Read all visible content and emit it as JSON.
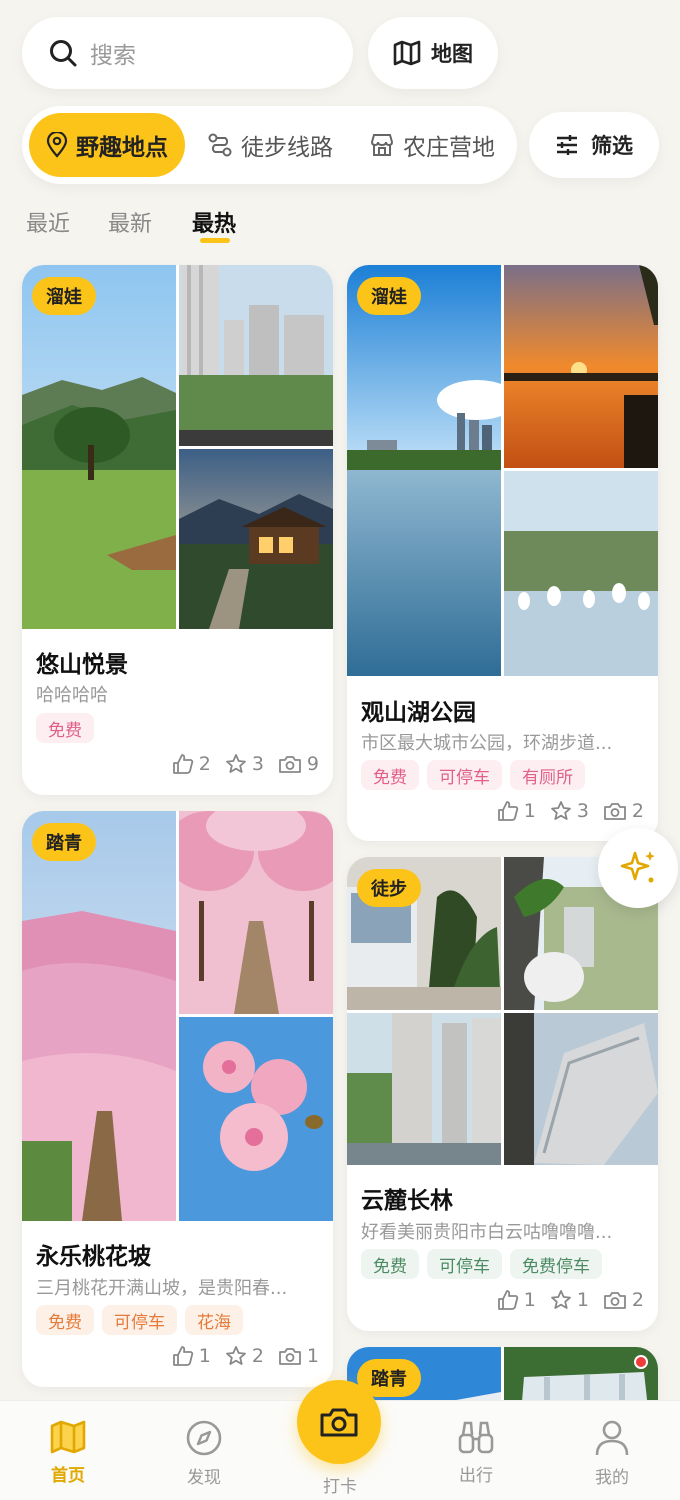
{
  "search": {
    "placeholder": "搜索"
  },
  "map_button": {
    "label": "地图"
  },
  "categories": [
    {
      "label": "野趣地点",
      "icon": "location-pin-icon",
      "active": true
    },
    {
      "label": "徒步线路",
      "icon": "route-icon",
      "active": false
    },
    {
      "label": "农庄营地",
      "icon": "farm-store-icon",
      "active": false
    }
  ],
  "filter_button": {
    "label": "筛选"
  },
  "sort_tabs": [
    {
      "label": "最近",
      "active": false
    },
    {
      "label": "最新",
      "active": false
    },
    {
      "label": "最热",
      "active": true
    }
  ],
  "cards": [
    {
      "badge": "溜娃",
      "title": "悠山悦景",
      "desc": "哈哈哈哈",
      "chips": [
        {
          "label": "免费",
          "style": "pink"
        }
      ],
      "likes": "2",
      "stars": "3",
      "photos": "9"
    },
    {
      "badge": "溜娃",
      "title": "观山湖公园",
      "desc": "市区最大城市公园，环湖步道...",
      "chips": [
        {
          "label": "免费",
          "style": "pink"
        },
        {
          "label": "可停车",
          "style": "pink"
        },
        {
          "label": "有厕所",
          "style": "pink"
        }
      ],
      "likes": "1",
      "stars": "3",
      "photos": "2"
    },
    {
      "badge": "踏青",
      "title": "永乐桃花坡",
      "desc": "三月桃花开满山坡，是贵阳春...",
      "chips": [
        {
          "label": "免费",
          "style": "orange"
        },
        {
          "label": "可停车",
          "style": "orange"
        },
        {
          "label": "花海",
          "style": "orange"
        }
      ],
      "likes": "1",
      "stars": "2",
      "photos": "1"
    },
    {
      "badge": "徒步",
      "title": "云麓长林",
      "desc": "好看美丽贵阳市白云咕噜噜噜...",
      "chips": [
        {
          "label": "免费",
          "style": "green"
        },
        {
          "label": "可停车",
          "style": "green"
        },
        {
          "label": "免费停车",
          "style": "green"
        }
      ],
      "likes": "1",
      "stars": "1",
      "photos": "2"
    },
    {
      "badge": "踏青"
    }
  ],
  "bottom_nav": [
    {
      "label": "首页",
      "icon": "map-icon",
      "active": true
    },
    {
      "label": "发现",
      "icon": "compass-icon",
      "active": false
    },
    {
      "label": "打卡",
      "icon": "camera-icon",
      "active": false
    },
    {
      "label": "出行",
      "icon": "binoculars-icon",
      "active": false
    },
    {
      "label": "我的",
      "icon": "person-icon",
      "active": false
    }
  ],
  "colors": {
    "accent": "#fcc419",
    "background": "#f6f4ef"
  }
}
